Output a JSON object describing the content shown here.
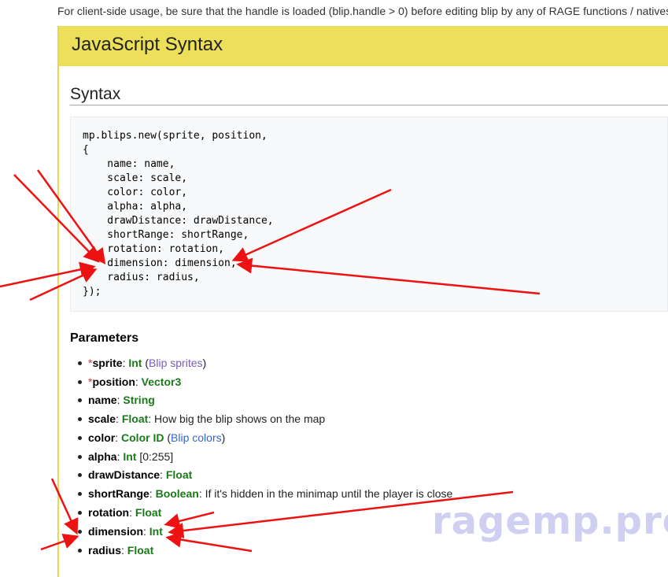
{
  "intro_text": "For client-side usage, be sure that the handle is loaded (blip.handle > 0) before editing blip by any of RAGE functions / natives",
  "box_title": "JavaScript Syntax",
  "syntax_heading": "Syntax",
  "code_lines": [
    "mp.blips.new(sprite, position,",
    "{",
    "    name: name,",
    "    scale: scale,",
    "    color: color,",
    "    alpha: alpha,",
    "    drawDistance: drawDistance,",
    "    shortRange: shortRange,",
    "    rotation: rotation,",
    "    dimension: dimension,",
    "    radius: radius,",
    "});"
  ],
  "parameters_heading": "Parameters",
  "parameters": [
    {
      "required": "*",
      "name": "sprite",
      "sep": ": ",
      "type": "Int",
      "extra_pre": " (",
      "link": "Blip sprites",
      "extra_post": ")"
    },
    {
      "required": "*",
      "name": "position",
      "sep": ": ",
      "type": "Vector3"
    },
    {
      "name": "name",
      "sep": ": ",
      "type": "String"
    },
    {
      "name": "scale",
      "sep": ": ",
      "type": "Float",
      "desc": ": How big the blip shows on the map"
    },
    {
      "name": "color",
      "sep": ": ",
      "type": "Color ID",
      "extra_pre": " (",
      "link": "Blip colors",
      "extra_post": ")"
    },
    {
      "name": "alpha",
      "sep": ": ",
      "type": "Int",
      "desc": " [0:255]"
    },
    {
      "name": "drawDistance",
      "sep": ": ",
      "type": "Float"
    },
    {
      "name": "shortRange",
      "sep": ": ",
      "type": "Boolean",
      "desc": ": If it's hidden in the minimap until the player is close"
    },
    {
      "name": "rotation",
      "sep": ": ",
      "type": "Float"
    },
    {
      "name": "dimension",
      "sep": ": ",
      "type": "Int"
    },
    {
      "name": "radius",
      "sep": ": ",
      "type": "Float"
    }
  ],
  "watermark": "ragemp.pro",
  "colors": {
    "header_bg": "#ece05a",
    "type_green": "#1a7a1a",
    "required_red": "#dd3333",
    "link_blue": "#3366cc",
    "annotation_arrow": "#ee1111"
  }
}
